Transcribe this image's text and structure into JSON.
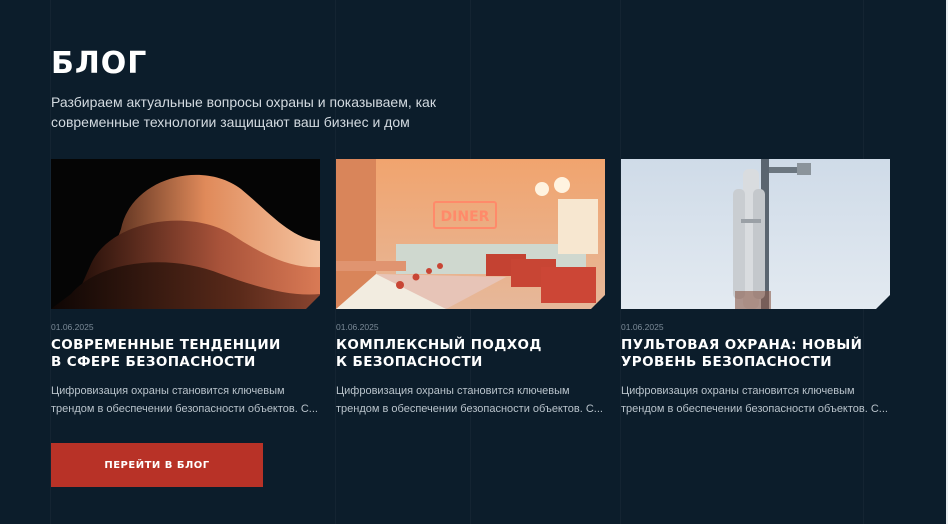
{
  "header": {
    "title": "БЛОГ",
    "subtitle": "Разбираем актуальные вопросы охраны и показываем, как современные технологии защищают ваш бизнес и дом"
  },
  "cards": [
    {
      "date": "01.06.2025",
      "title": "СОВРЕМЕННЫЕ ТЕНДЕНЦИИ\nВ СФЕРЕ БЕЗОПАСНОСТИ",
      "excerpt": "Цифровизация охраны становится ключевым\nтрендом в обеспечении безопасности объектов. С..."
    },
    {
      "date": "01.06.2025",
      "title": "КОМПЛЕКСНЫЙ ПОДХОД\nК БЕЗОПАСНОСТИ",
      "excerpt": "Цифровизация охраны становится ключевым\nтрендом в обеспечении безопасности объектов. С...",
      "sign_text": "DINER"
    },
    {
      "date": "01.06.2025",
      "title": "ПУЛЬТОВАЯ ОХРАНА: НОВЫЙ\nУРОВЕНЬ БЕЗОПАСНОСТИ",
      "excerpt": "Цифровизация охраны становится ключевым\nтрендом в обеспечении безопасности объектов. С..."
    }
  ],
  "cta": {
    "label": "ПЕРЕЙТИ В БЛОГ"
  },
  "colors": {
    "background": "#0c1d2b",
    "accent": "#b83227"
  }
}
